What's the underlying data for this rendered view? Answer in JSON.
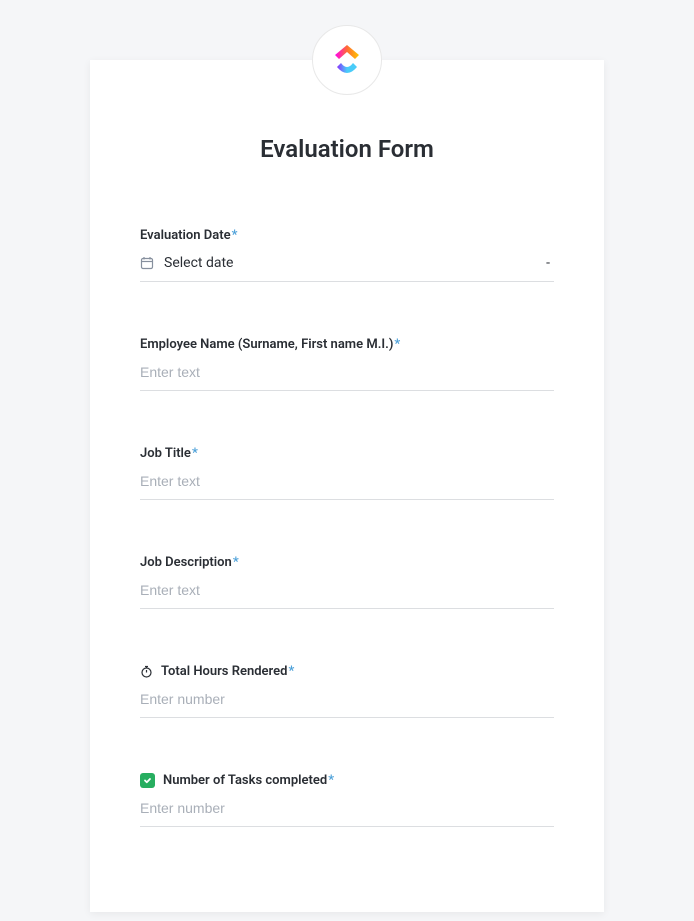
{
  "form": {
    "title": "Evaluation Form",
    "fields": {
      "evaluationDate": {
        "label": "Evaluation Date",
        "placeholder": "Select date",
        "required": true
      },
      "employeeName": {
        "label": "Employee Name (Surname, First name M.I.)",
        "placeholder": "Enter text",
        "required": true
      },
      "jobTitle": {
        "label": "Job Title",
        "placeholder": "Enter text",
        "required": true
      },
      "jobDescription": {
        "label": "Job Description",
        "placeholder": "Enter text",
        "required": true
      },
      "totalHours": {
        "label": "Total Hours Rendered",
        "placeholder": "Enter number",
        "required": true
      },
      "tasksCompleted": {
        "label": "Number of Tasks completed",
        "placeholder": "Enter number",
        "required": true
      }
    },
    "asterisk": "*",
    "dateDash": "-"
  }
}
